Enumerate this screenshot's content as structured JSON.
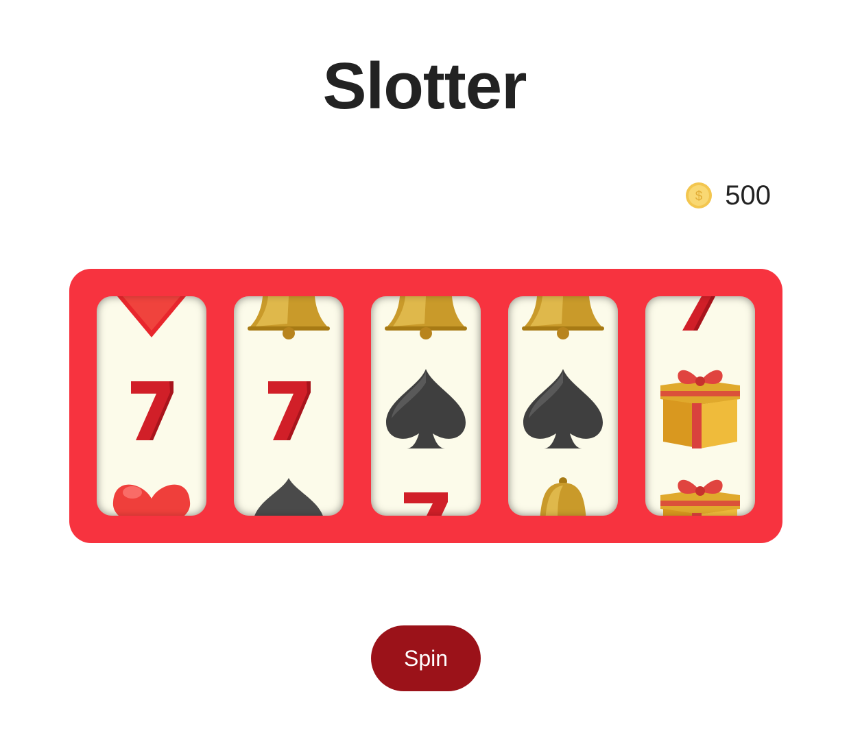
{
  "app": {
    "title": "Slotter"
  },
  "balance": {
    "icon": "coin-icon",
    "value": "500"
  },
  "machine": {
    "frame_color": "#f7333f",
    "reel_background": "#fcfbea",
    "reels": [
      {
        "symbols": [
          "heart",
          "seven",
          "heart"
        ]
      },
      {
        "symbols": [
          "bell",
          "seven",
          "spade"
        ]
      },
      {
        "symbols": [
          "bell",
          "spade",
          "seven"
        ]
      },
      {
        "symbols": [
          "bell",
          "spade",
          "bell"
        ]
      },
      {
        "symbols": [
          "seven",
          "gift",
          "gift"
        ]
      }
    ]
  },
  "controls": {
    "spin_label": "Spin",
    "spin_color": "#9b1219"
  }
}
